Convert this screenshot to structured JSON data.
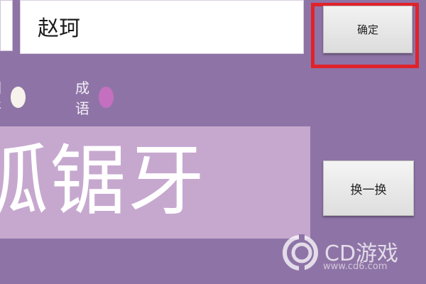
{
  "name_field": {
    "value": "赵珂"
  },
  "confirm_button": {
    "label": "确定"
  },
  "modes": [
    {
      "label": "词语",
      "dot_color": "#f7f3ec"
    },
    {
      "label": "成语",
      "dot_color": "#c56fc0"
    }
  ],
  "display": {
    "text": "狐锯牙"
  },
  "swap_button": {
    "label": "换一换"
  },
  "watermark": {
    "brand": "CD游戏",
    "url": "www.cd6.com"
  },
  "colors": {
    "background": "#8e74a6",
    "display_box": "#c6a8cf",
    "highlight_frame": "#e0232a"
  }
}
